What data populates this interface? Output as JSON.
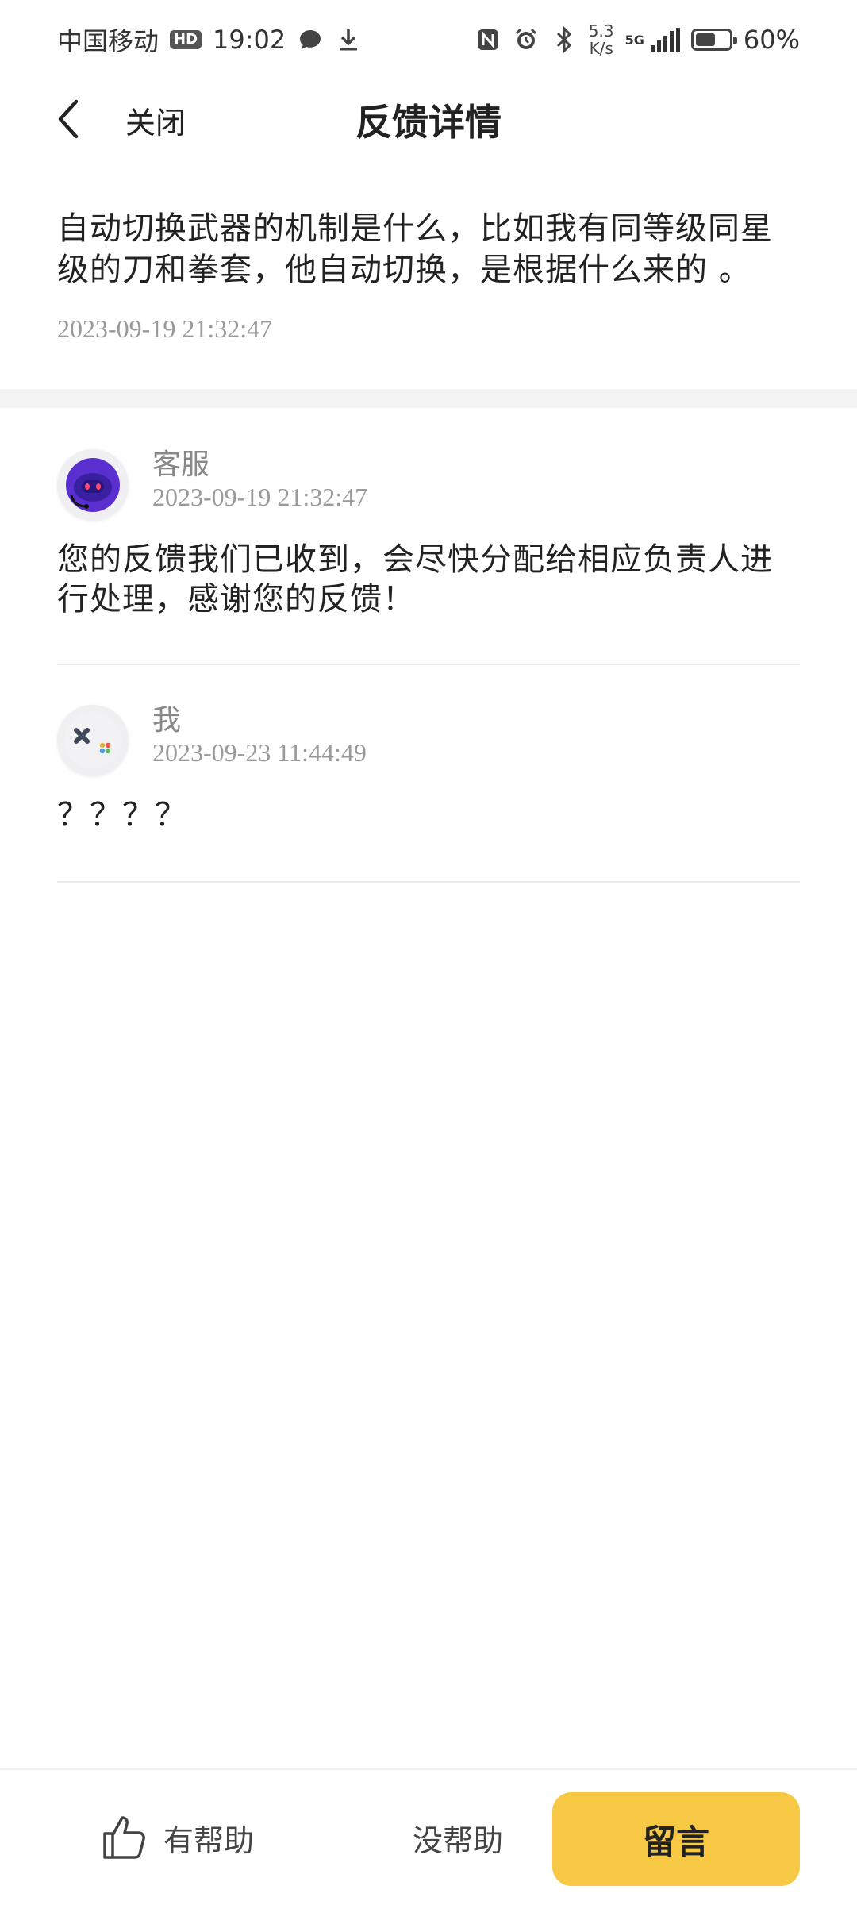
{
  "status_bar": {
    "carrier": "中国移动",
    "hd": "HD",
    "time": "19:02",
    "speed_value": "5.3",
    "speed_unit": "K/s",
    "network": "5G",
    "battery": "60%",
    "battery_level": 0.6,
    "icons": [
      "message-icon",
      "download-icon",
      "nfc-icon",
      "alarm-icon",
      "bluetooth-icon",
      "signal-icon",
      "battery-icon"
    ]
  },
  "header": {
    "back_icon": "chevron-left-icon",
    "close_label": "关闭",
    "title": "反馈详情"
  },
  "question": {
    "text": "自动切换武器的机制是什么，比如我有同等级同星级的刀和拳套，他自动切换，是根据什么来的 。",
    "time": "2023-09-19 21:32:47"
  },
  "replies": [
    {
      "avatar": "robot-support-avatar",
      "name": "客服",
      "time": "2023-09-19 21:32:47",
      "body": "您的反馈我们已收到，会尽快分配给相应负责人进行处理，感谢您的反馈！"
    },
    {
      "avatar": "gamepad-avatar",
      "name": "我",
      "time": "2023-09-23 11:44:49",
      "body": "？？？？"
    }
  ],
  "bottom_bar": {
    "helpful_label": "有帮助",
    "unhelpful_label": "没帮助",
    "comment_label": "留言",
    "accent_color": "#f6c843"
  }
}
